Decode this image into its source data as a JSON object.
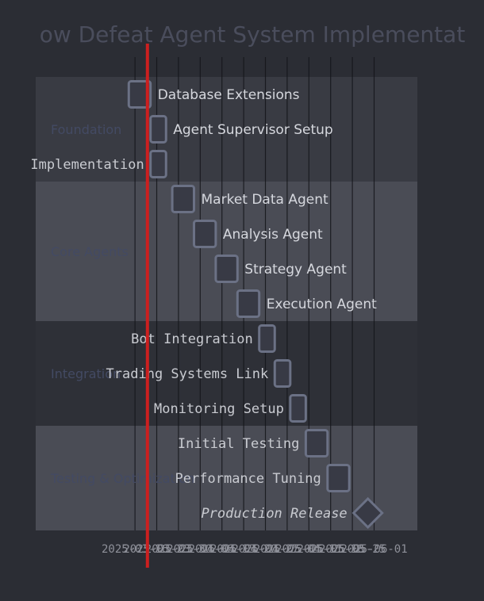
{
  "chart_data": {
    "type": "gantt",
    "title": "ow Defeat Agent System Implementat",
    "sections": [
      {
        "name": "Foundation",
        "fill": "#393b43",
        "tasks": [
          {
            "name": "Database Extensions",
            "start": "2025-03-14",
            "end": "2025-03-21",
            "kind": "task",
            "label_style": "sans"
          },
          {
            "name": "Agent Supervisor Setup",
            "start": "2025-03-21",
            "end": "2025-03-26",
            "kind": "task",
            "label_style": "sans"
          },
          {
            "name": "Implementation",
            "start": "2025-03-21",
            "end": "2025-03-26",
            "kind": "task",
            "label_style": "mono"
          }
        ]
      },
      {
        "name": "Core Agents",
        "fill": "#4a4c55",
        "tasks": [
          {
            "name": "Market Data Agent",
            "start": "2025-03-28",
            "end": "2025-04-04",
            "kind": "task",
            "label_style": "sans"
          },
          {
            "name": "Analysis Agent",
            "start": "2025-04-04",
            "end": "2025-04-11",
            "kind": "task",
            "label_style": "sans"
          },
          {
            "name": "Strategy Agent",
            "start": "2025-04-11",
            "end": "2025-04-18",
            "kind": "task",
            "label_style": "sans"
          },
          {
            "name": "Execution Agent",
            "start": "2025-04-18",
            "end": "2025-04-25",
            "kind": "task",
            "label_style": "sans"
          }
        ]
      },
      {
        "name": "Integration",
        "fill": "#2e3037",
        "tasks": [
          {
            "name": "Bot Integration",
            "start": "2025-04-25",
            "end": "2025-04-30",
            "kind": "task",
            "label_style": "mono"
          },
          {
            "name": "Trading Systems Link",
            "start": "2025-04-30",
            "end": "2025-05-05",
            "kind": "task",
            "label_style": "mono"
          },
          {
            "name": "Monitoring Setup",
            "start": "2025-05-05",
            "end": "2025-05-10",
            "kind": "task",
            "label_style": "mono"
          }
        ]
      },
      {
        "name": "Testing & Optimization",
        "fill": "#4a4c55",
        "tasks": [
          {
            "name": "Initial Testing",
            "start": "2025-05-10",
            "end": "2025-05-17",
            "kind": "task",
            "label_style": "mono"
          },
          {
            "name": "Performance Tuning",
            "start": "2025-05-17",
            "end": "2025-05-24",
            "kind": "task",
            "label_style": "mono"
          },
          {
            "name": "Production Release",
            "start": "2025-05-30",
            "end": "2025-05-30",
            "kind": "milestone",
            "label_style": "ms"
          }
        ]
      }
    ],
    "x_domain": [
      "2025-03-06",
      "2025-06-30"
    ],
    "ticks": [
      "2025-03-16",
      "2025-03-23",
      "2025-03-30",
      "2025-04-06",
      "2025-04-13",
      "2025-04-20",
      "2025-04-27",
      "2025-05-04",
      "2025-05-11",
      "2025-05-18",
      "2025-05-25",
      "2025-06-01"
    ],
    "today": "2025-03-20",
    "colors": {
      "bar_fill": "#383a45",
      "bar_stroke": "#6b7185",
      "today_line": "#cc1f1f",
      "grid": "#14151a"
    }
  }
}
